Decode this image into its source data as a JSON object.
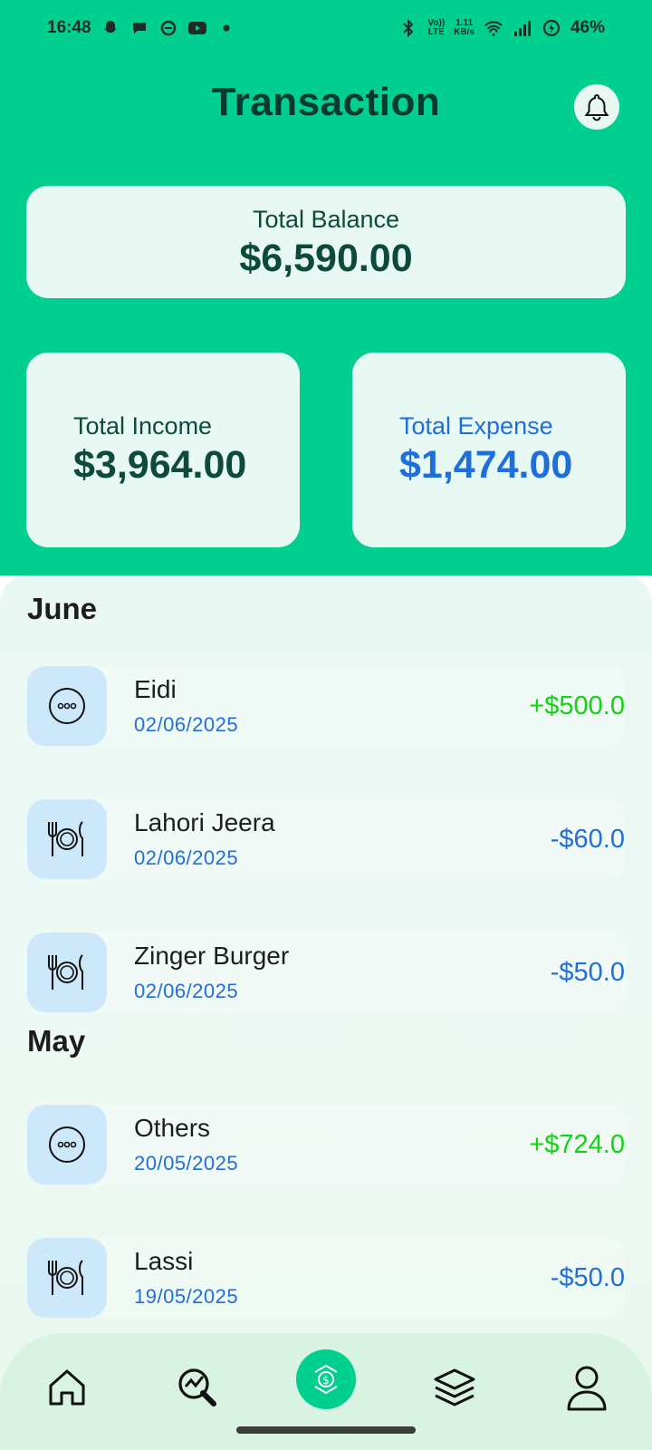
{
  "status": {
    "time": "16:48",
    "volte": "Vo))",
    "lte": "LTE",
    "speed_value": "1.11",
    "speed_unit": "KB/s",
    "battery": "46%"
  },
  "header": {
    "title": "Transaction"
  },
  "balance": {
    "label": "Total Balance",
    "value": "$6,590.00"
  },
  "income": {
    "label": "Total Income",
    "value": "$3,964.00"
  },
  "expense": {
    "label": "Total Expense",
    "value": "$1,474.00"
  },
  "groups": [
    {
      "month": "June",
      "items": [
        {
          "name": "Eidi",
          "date": "02/06/2025",
          "amount": "+$500.0",
          "icon": "others-icon"
        },
        {
          "name": "Lahori Jeera",
          "date": "02/06/2025",
          "amount": "-$60.0",
          "icon": "food-icon"
        },
        {
          "name": "Zinger Burger",
          "date": "02/06/2025",
          "amount": "-$50.0",
          "icon": "food-icon"
        }
      ]
    },
    {
      "month": "May",
      "items": [
        {
          "name": "Others",
          "date": "20/05/2025",
          "amount": "+$724.0",
          "icon": "others-icon"
        },
        {
          "name": "Lassi",
          "date": "19/05/2025",
          "amount": "-$50.0",
          "icon": "food-icon"
        }
      ]
    }
  ],
  "colors": {
    "brand": "#00CF90",
    "income_amount": "#0fd40f",
    "expense_amount": "#1e6fdc",
    "icon_bg": "#cde7fb"
  },
  "nav": [
    "home-icon",
    "analytics-icon",
    "transaction-icon",
    "layers-icon",
    "profile-icon"
  ]
}
